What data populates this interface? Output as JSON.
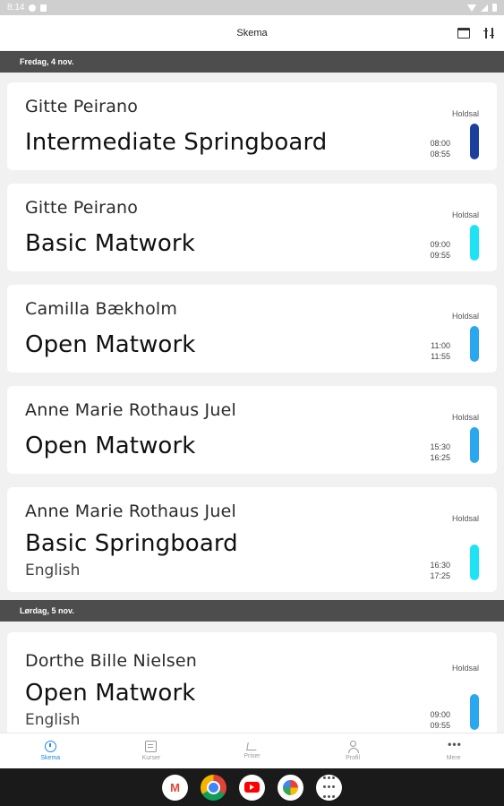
{
  "status_bar": {
    "time": "8:14"
  },
  "app_bar": {
    "title": "Skema",
    "calendar_icon": "calendar-view-icon",
    "filter_icon": "filter-sliders-icon"
  },
  "days": [
    {
      "label": "Fredag, 4 nov.",
      "classes": [
        {
          "teacher": "Gitte  Peirano",
          "course": "Intermediate Springboard",
          "language": "",
          "room": "Holdsal",
          "start": "08:00",
          "end": "08:55",
          "color": "#1a3f9e"
        },
        {
          "teacher": "Gitte  Peirano",
          "course": "Basic Matwork",
          "language": "",
          "room": "Holdsal",
          "start": "09:00",
          "end": "09:55",
          "color": "#1ee3f5"
        },
        {
          "teacher": "Camilla Bækholm",
          "course": "Open Matwork",
          "language": "",
          "room": "Holdsal",
          "start": "11:00",
          "end": "11:55",
          "color": "#2aa7ee"
        },
        {
          "teacher": "Anne Marie Rothaus Juel",
          "course": "Open Matwork",
          "language": "",
          "room": "Holdsal",
          "start": "15:30",
          "end": "16:25",
          "color": "#2aa7ee"
        },
        {
          "teacher": "Anne Marie Rothaus Juel",
          "course": "Basic Springboard",
          "language": "English",
          "room": "Holdsal",
          "start": "16:30",
          "end": "17:25",
          "color": "#1ee3f5"
        }
      ]
    },
    {
      "label": "Lørdag, 5 nov.",
      "classes": [
        {
          "teacher": "Dorthe Bille Nielsen",
          "course": "Open Matwork",
          "language": "English",
          "room": "Holdsal",
          "start": "09:00",
          "end": "09:55",
          "color": "#2aa7ee"
        }
      ]
    }
  ],
  "bottom_nav": [
    {
      "label": "Skema",
      "icon": "clock-icon",
      "active": true
    },
    {
      "label": "Kurser",
      "icon": "list-icon",
      "active": false
    },
    {
      "label": "Priser",
      "icon": "cart-icon",
      "active": false
    },
    {
      "label": "Profil",
      "icon": "person-icon",
      "active": false
    },
    {
      "label": "Mere",
      "icon": "more-icon",
      "active": false
    }
  ],
  "dock": [
    {
      "name": "gmail-icon",
      "glyph": "M"
    },
    {
      "name": "chrome-icon",
      "glyph": ""
    },
    {
      "name": "youtube-icon",
      "glyph": ""
    },
    {
      "name": "photos-icon",
      "glyph": ""
    },
    {
      "name": "app-drawer-icon",
      "glyph": ""
    }
  ],
  "colors": {
    "active": "#1e88e5",
    "day_header_bg": "#4d4d4d"
  }
}
